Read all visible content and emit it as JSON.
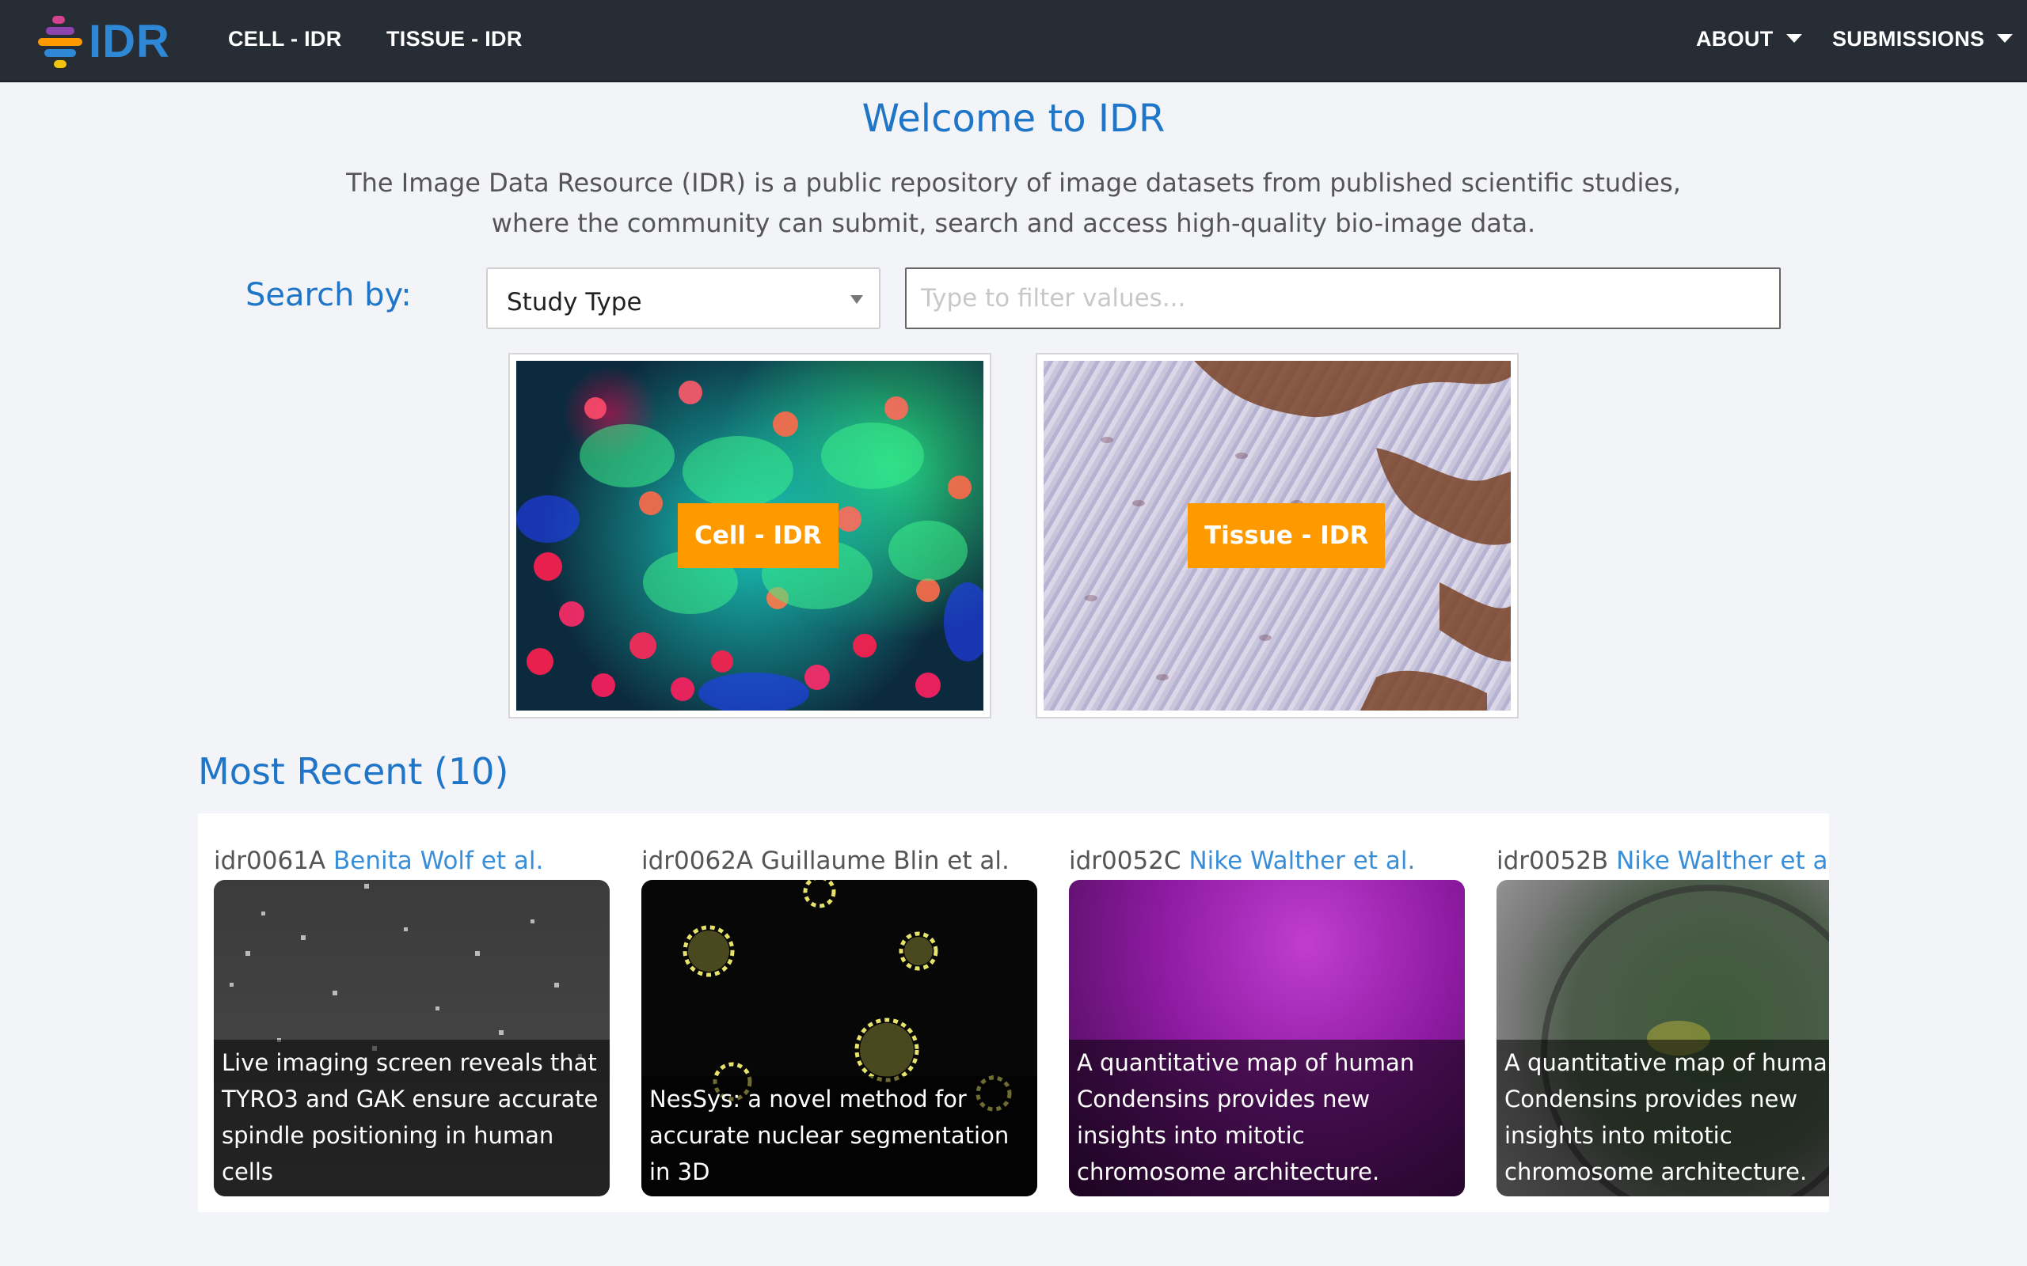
{
  "navbar": {
    "logo_text": "IDR",
    "logo_colors": [
      "#d4438f",
      "#8e44ad",
      "#ff9900",
      "#2e88d6",
      "#f1c40f"
    ],
    "links": [
      {
        "label": "CELL - IDR"
      },
      {
        "label": "TISSUE - IDR"
      }
    ],
    "menus": [
      {
        "label": "ABOUT"
      },
      {
        "label": "SUBMISSIONS"
      }
    ]
  },
  "hero": {
    "title": "Welcome to IDR",
    "intro_line1": "The Image Data Resource (IDR) is a public repository of image datasets from published scientific studies,",
    "intro_line2": "where the community can submit, search and access high-quality bio-image data."
  },
  "search": {
    "label": "Search by:",
    "selected": "Study Type",
    "placeholder": "Type to filter values..."
  },
  "categories": [
    {
      "label": "Cell - IDR"
    },
    {
      "label": "Tissue - IDR"
    }
  ],
  "recent": {
    "title": "Most Recent (10)",
    "cards": [
      {
        "id": "idr0061A",
        "author": "Benita Wolf et al.",
        "author_linked": true,
        "caption": "Live imaging screen reveals that TYRO3 and GAK ensure accurate spindle positioning in human cells"
      },
      {
        "id": "idr0062A",
        "author": "Guillaume Blin et al.",
        "author_linked": false,
        "caption": "NesSys: a novel method for accurate nuclear segmentation in 3D"
      },
      {
        "id": "idr0052C",
        "author": "Nike Walther et al.",
        "author_linked": true,
        "caption": "A quantitative map of human Condensins provides new insights into mitotic chromosome architecture."
      },
      {
        "id": "idr0052B",
        "author": "Nike Walther et al.",
        "author_linked": true,
        "caption": "A quantitative map of human Condensins provides new insights into mitotic chromosome architecture."
      }
    ]
  },
  "colors": {
    "navbar_bg": "#262d35",
    "accent_blue": "#1f76c8",
    "link_blue": "#3a8ed8",
    "button_orange": "#ff9900",
    "page_bg": "#f2f4f8"
  }
}
